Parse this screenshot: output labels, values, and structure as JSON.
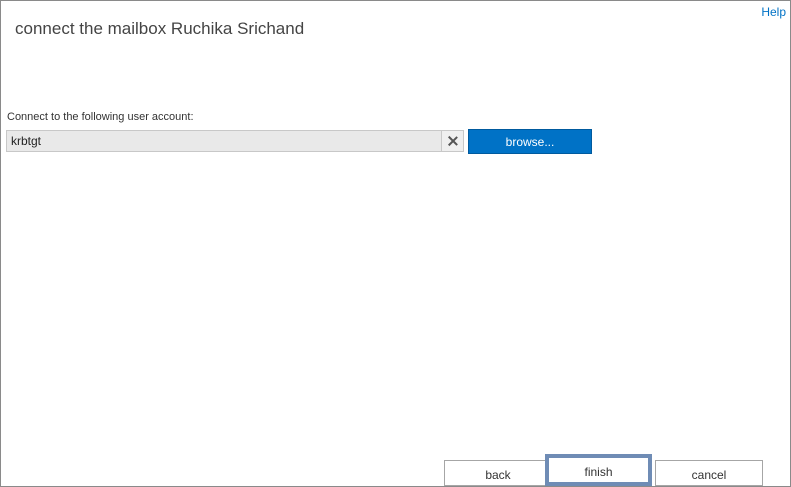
{
  "help_label": "Help",
  "title": "connect the mailbox Ruchika Srichand",
  "account": {
    "label": "Connect to the following user account:",
    "value": "krbtgt",
    "browse_label": "browse..."
  },
  "footer": {
    "back_label": "back",
    "finish_label": "finish",
    "cancel_label": "cancel"
  },
  "colors": {
    "accent": "#0072c6",
    "focus_border": "#6f8cb5"
  }
}
